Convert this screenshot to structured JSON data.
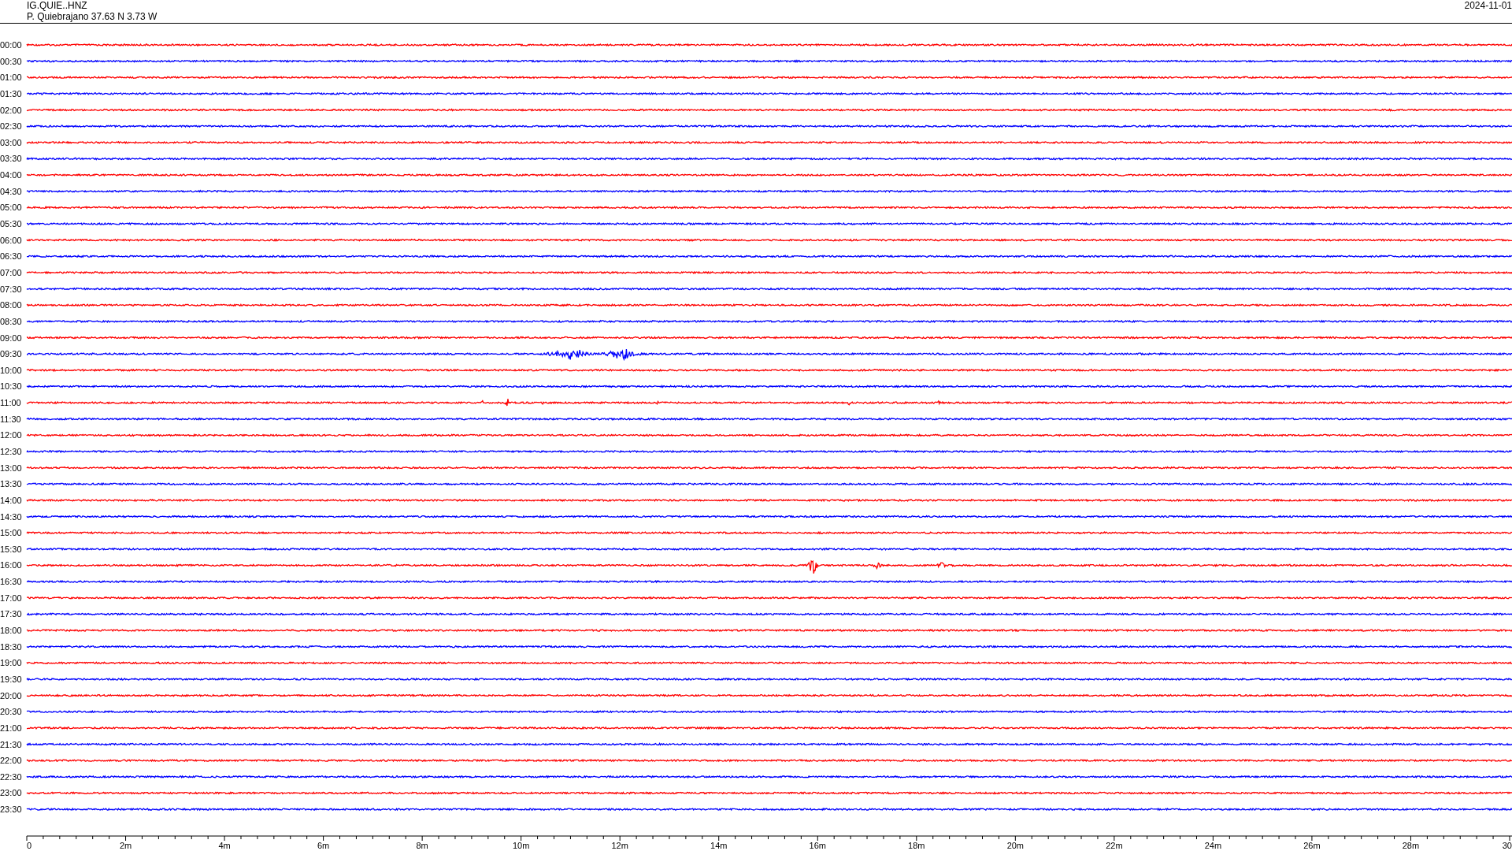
{
  "header": {
    "station": "IG.QUIE..HNZ",
    "location": "P. Quiebrajano  37.63 N 3.73 W",
    "date": "2024-11-01"
  },
  "rows": [
    {
      "time": "00:00",
      "color": "#ff0000"
    },
    {
      "time": "00:30",
      "color": "#0000ff"
    },
    {
      "time": "01:00",
      "color": "#ff0000"
    },
    {
      "time": "01:30",
      "color": "#0000ff"
    },
    {
      "time": "02:00",
      "color": "#ff0000"
    },
    {
      "time": "02:30",
      "color": "#0000ff"
    },
    {
      "time": "03:00",
      "color": "#ff0000"
    },
    {
      "time": "03:30",
      "color": "#0000ff"
    },
    {
      "time": "04:00",
      "color": "#ff0000"
    },
    {
      "time": "04:30",
      "color": "#0000ff"
    },
    {
      "time": "05:00",
      "color": "#ff0000"
    },
    {
      "time": "05:30",
      "color": "#0000ff"
    },
    {
      "time": "06:00",
      "color": "#ff0000"
    },
    {
      "time": "06:30",
      "color": "#0000ff"
    },
    {
      "time": "07:00",
      "color": "#ff0000"
    },
    {
      "time": "07:30",
      "color": "#0000ff"
    },
    {
      "time": "08:00",
      "color": "#ff0000"
    },
    {
      "time": "08:30",
      "color": "#0000ff"
    },
    {
      "time": "09:00",
      "color": "#ff0000"
    },
    {
      "time": "09:30",
      "color": "#0000ff"
    },
    {
      "time": "10:00",
      "color": "#ff0000"
    },
    {
      "time": "10:30",
      "color": "#0000ff"
    },
    {
      "time": "11:00",
      "color": "#ff0000"
    },
    {
      "time": "11:30",
      "color": "#0000ff"
    },
    {
      "time": "12:00",
      "color": "#ff0000"
    },
    {
      "time": "12:30",
      "color": "#0000ff"
    },
    {
      "time": "13:00",
      "color": "#ff0000"
    },
    {
      "time": "13:30",
      "color": "#0000ff"
    },
    {
      "time": "14:00",
      "color": "#ff0000"
    },
    {
      "time": "14:30",
      "color": "#0000ff"
    },
    {
      "time": "15:00",
      "color": "#ff0000"
    },
    {
      "time": "15:30",
      "color": "#0000ff"
    },
    {
      "time": "16:00",
      "color": "#ff0000"
    },
    {
      "time": "16:30",
      "color": "#0000ff"
    },
    {
      "time": "17:00",
      "color": "#ff0000"
    },
    {
      "time": "17:30",
      "color": "#0000ff"
    },
    {
      "time": "18:00",
      "color": "#ff0000"
    },
    {
      "time": "18:30",
      "color": "#0000ff"
    },
    {
      "time": "19:00",
      "color": "#ff0000"
    },
    {
      "time": "19:30",
      "color": "#0000ff"
    },
    {
      "time": "20:00",
      "color": "#ff0000"
    },
    {
      "time": "20:30",
      "color": "#0000ff"
    },
    {
      "time": "21:00",
      "color": "#ff0000"
    },
    {
      "time": "21:30",
      "color": "#0000ff"
    },
    {
      "time": "22:00",
      "color": "#ff0000"
    },
    {
      "time": "22:30",
      "color": "#0000ff"
    },
    {
      "time": "23:00",
      "color": "#ff0000"
    },
    {
      "time": "23:30",
      "color": "#0000ff"
    }
  ],
  "x_axis": {
    "labels": [
      "0",
      "2m",
      "4m",
      "6m",
      "8m",
      "10m",
      "12m",
      "14m",
      "16m",
      "18m",
      "20m",
      "22m",
      "24m",
      "26m",
      "28m",
      "30"
    ]
  }
}
